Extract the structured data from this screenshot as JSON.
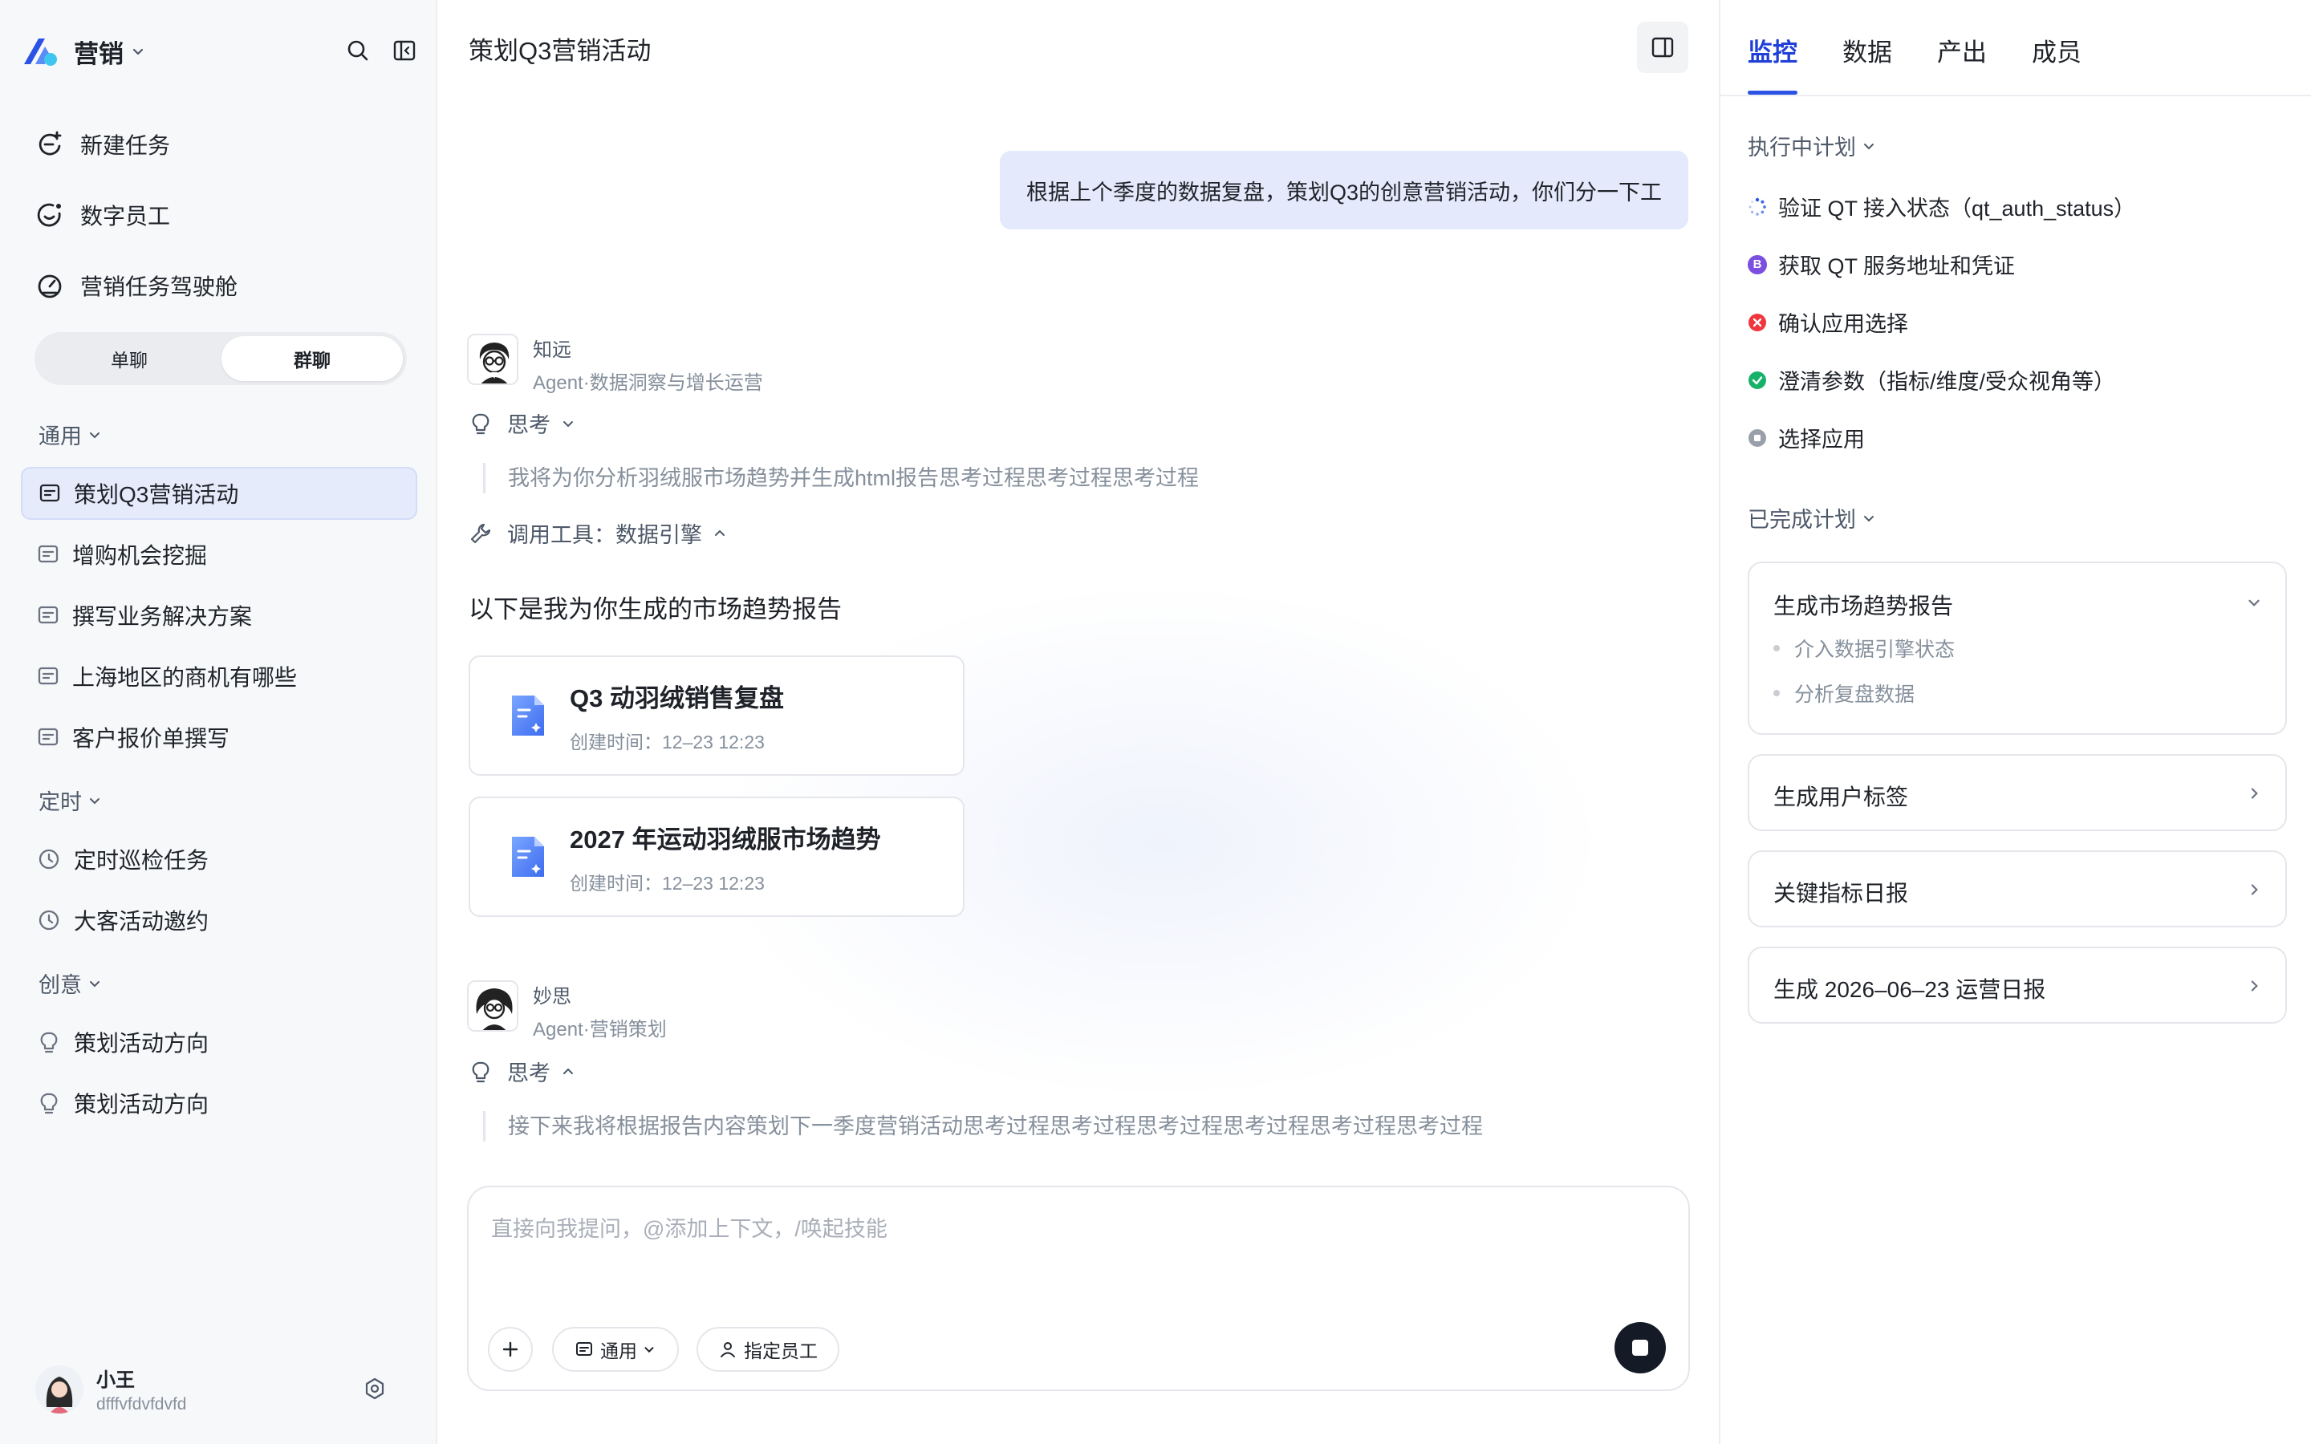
{
  "sidebar": {
    "app_name": "营销",
    "nav": [
      "新建任务",
      "数字员工",
      "营销任务驾驶舱"
    ],
    "chat_mode": {
      "single": "单聊",
      "group": "群聊",
      "selected": "群聊"
    },
    "sections": [
      {
        "title": "通用",
        "items": [
          "策划Q3营销活动",
          "增购机会挖掘",
          "撰写业务解决方案",
          "上海地区的商机有哪些",
          "客户报价单撰写"
        ]
      },
      {
        "title": "定时",
        "items": [
          "定时巡检任务",
          "大客活动邀约"
        ]
      },
      {
        "title": "创意",
        "items": [
          "策划活动方向",
          "策划活动方向"
        ]
      }
    ],
    "active_item": "策划Q3营销活动",
    "user": {
      "name": "小王",
      "id": "dfffvfdvfdvfd"
    }
  },
  "main": {
    "title": "策划Q3营销活动",
    "user_message": "根据上个季度的数据复盘，策划Q3的创意营销活动，你们分一下工",
    "agent1": {
      "name": "知远",
      "role": "Agent·数据洞察与增长运营",
      "think_label": "思考",
      "think_text": "我将为你分析羽绒服市场趋势并生成html报告思考过程思考过程思考过程",
      "tool_label": "调用工具：数据引擎",
      "answer": "以下是我为你生成的市场趋势报告",
      "files": [
        {
          "title": "Q3 动羽绒销售复盘",
          "time": "创建时间：12–23 12:23"
        },
        {
          "title": "2027 年运动羽绒服市场趋势",
          "time": "创建时间：12–23 12:23"
        }
      ]
    },
    "agent2": {
      "name": "妙思",
      "role": "Agent·营销策划",
      "think_label": "思考",
      "think_text": "接下来我将根据报告内容策划下一季度营销活动思考过程思考过程思考过程思考过程思考过程思考过程"
    },
    "composer": {
      "placeholder": "直接向我提问，@添加上下文，/唤起技能",
      "mode_label": "通用",
      "assign_label": "指定员工"
    }
  },
  "right_panel": {
    "tabs": [
      "监控",
      "数据",
      "产出",
      "成员"
    ],
    "active_tab": "监控",
    "running_title": "执行中计划",
    "running_plans": [
      {
        "label": "验证 QT 接入状态（qt_auth_status）",
        "status": "loading"
      },
      {
        "label": "获取 QT 服务地址和凭证",
        "status": "badge-b"
      },
      {
        "label": "确认应用选择",
        "status": "error"
      },
      {
        "label": "澄清参数（指标/维度/受众视角等）",
        "status": "success"
      },
      {
        "label": "选择应用",
        "status": "pending"
      }
    ],
    "done_title": "已完成计划",
    "done_plans": [
      {
        "title": "生成市场趋势报告",
        "expanded": true,
        "steps": [
          "介入数据引擎状态",
          "分析复盘数据"
        ]
      },
      {
        "title": "生成用户标签",
        "expanded": false
      },
      {
        "title": "关键指标日报",
        "expanded": false
      },
      {
        "title": "生成 2026–06–23 运营日报",
        "expanded": false
      }
    ],
    "status_colors": {
      "loading": "#2b52e5",
      "badge-b": "#7b4fe0",
      "error": "#f0353d",
      "success": "#17b26a",
      "pending": "#9aa0aa"
    }
  }
}
